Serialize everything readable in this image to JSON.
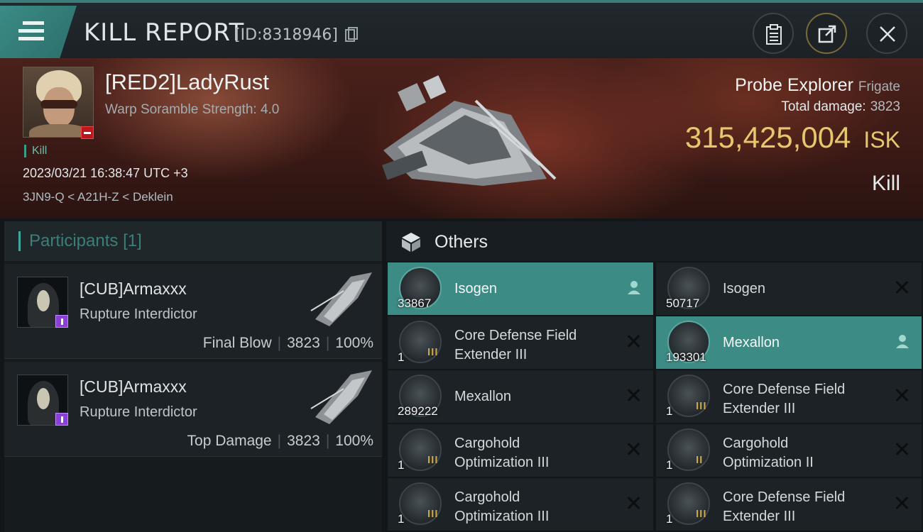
{
  "header": {
    "title": "KILL REPORT",
    "report_id": "[ID:8318946]"
  },
  "victim": {
    "name": "[RED2]LadyRust",
    "warp_scramble": "Warp Soramble Strength: 4.0",
    "tag": "Kill",
    "datetime": "2023/03/21 16:38:47 UTC +3",
    "location": "3JN9-Q < A21H-Z < Deklein",
    "ship": "Probe Explorer",
    "ship_class": "Frigate",
    "total_damage_label": "Total damage:",
    "total_damage": "3823",
    "isk_value": "315,425,004",
    "isk_unit": "ISK",
    "result": "Kill"
  },
  "participants": {
    "title": "Participants",
    "count": "[1]",
    "cards": [
      {
        "name": "[CUB]Armaxxx",
        "ship": "Rupture Interdictor",
        "role": "Final Blow",
        "damage": "3823",
        "percent": "100%"
      },
      {
        "name": "[CUB]Armaxxx",
        "ship": "Rupture Interdictor",
        "role": "Top Damage",
        "damage": "3823",
        "percent": "100%"
      }
    ]
  },
  "others": {
    "title": "Others",
    "items": [
      {
        "name": "Isogen",
        "qty": "33867",
        "tier": "",
        "icon": "isogen-icon",
        "highlighted": true,
        "action": "person-icon"
      },
      {
        "name": "Isogen",
        "qty": "50717",
        "tier": "",
        "icon": "isogen-icon",
        "highlighted": false,
        "action": "close-icon"
      },
      {
        "name_1": "Core Defense Field",
        "name_2": "Extender III",
        "qty": "1",
        "tier": "III",
        "icon": "shield-extender-icon",
        "highlighted": false,
        "action": "close-icon"
      },
      {
        "name": "Mexallon",
        "qty": "193301",
        "tier": "",
        "icon": "mexallon-icon",
        "highlighted": true,
        "action": "person-icon"
      },
      {
        "name": "Mexallon",
        "qty": "289222",
        "tier": "",
        "icon": "mexallon-icon",
        "highlighted": false,
        "action": "close-icon"
      },
      {
        "name_1": "Core Defense Field",
        "name_2": "Extender III",
        "qty": "1",
        "tier": "III",
        "icon": "shield-extender-icon",
        "highlighted": false,
        "action": "close-icon"
      },
      {
        "name_1": "Cargohold",
        "name_2": "Optimization III",
        "qty": "1",
        "tier": "III",
        "icon": "cargohold-icon",
        "highlighted": false,
        "action": "close-icon"
      },
      {
        "name_1": "Cargohold",
        "name_2": "Optimization II",
        "qty": "1",
        "tier": "II",
        "icon": "cargohold-icon",
        "highlighted": false,
        "action": "close-icon"
      },
      {
        "name_1": "Cargohold",
        "name_2": "Optimization III",
        "qty": "1",
        "tier": "III",
        "icon": "cargohold-icon",
        "highlighted": false,
        "action": "close-icon"
      },
      {
        "name_1": "Core Defense Field",
        "name_2": "Extender III",
        "qty": "1",
        "tier": "III",
        "icon": "shield-extender-icon",
        "highlighted": false,
        "action": "close-icon"
      }
    ]
  },
  "colors": {
    "accent_teal": "#3d8b85",
    "isk_gold": "#e5c86e",
    "warning_red": "#b8181e",
    "rank_purple": "#8a3fd6"
  }
}
